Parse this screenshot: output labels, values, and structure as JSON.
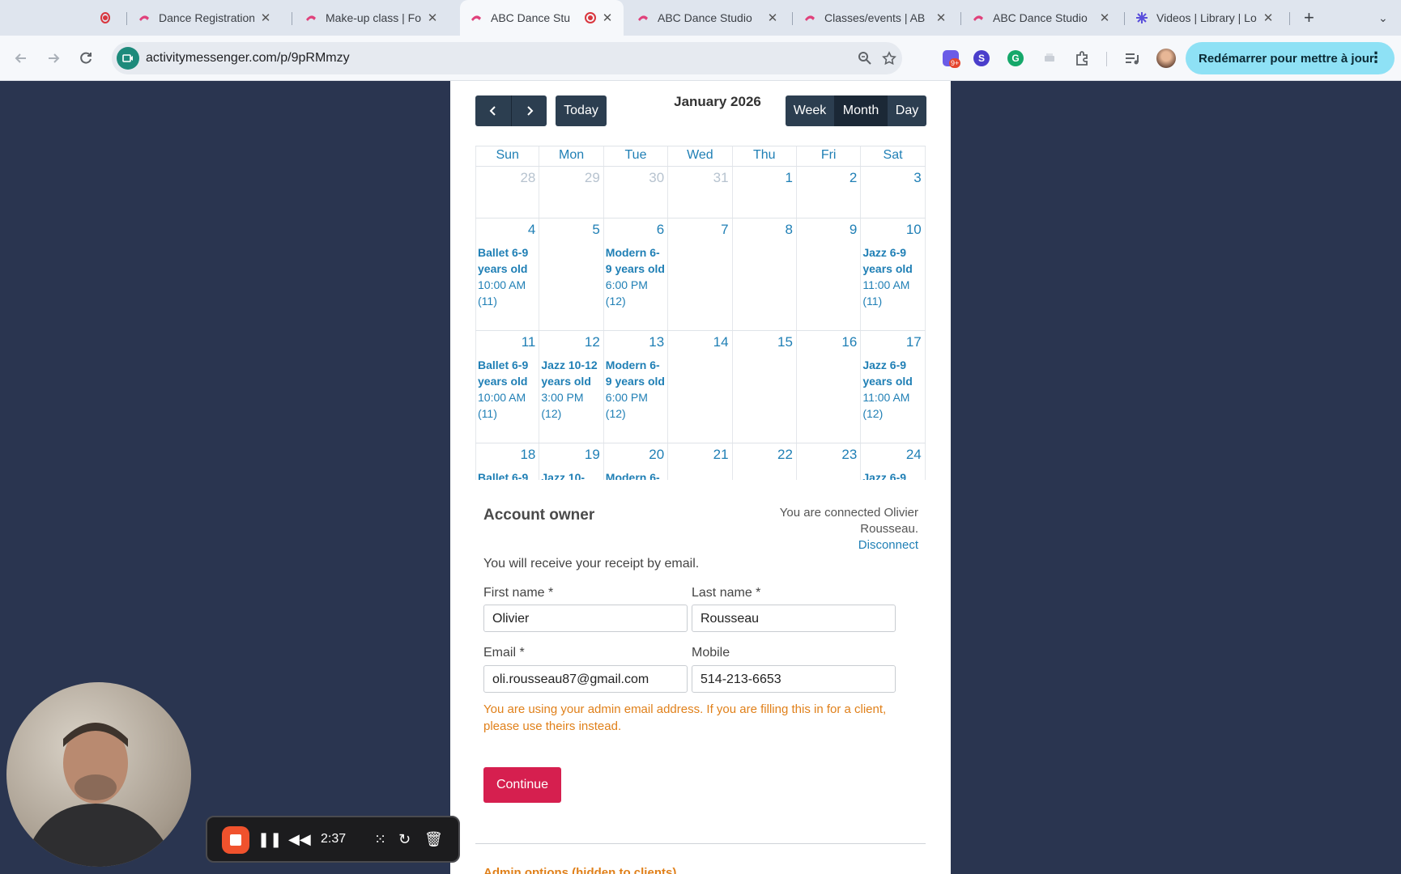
{
  "tabs": [
    {
      "title": "",
      "closable": false
    },
    {
      "title": "Dance Registration",
      "closable": true
    },
    {
      "title": "Make-up class | For",
      "closable": true
    },
    {
      "title": "ABC Dance Stu",
      "closable": true
    },
    {
      "title": "ABC Dance Studio",
      "closable": true
    },
    {
      "title": "Classes/events | AB",
      "closable": true
    },
    {
      "title": "ABC Dance Studio",
      "closable": true
    },
    {
      "title": "Videos | Library | Lo",
      "closable": true
    }
  ],
  "address_bar": {
    "url": "activitymessenger.com/p/9pRMmzy"
  },
  "update_button": {
    "label": "Redémarrer pour mettre à jour"
  },
  "extension_badge": "9+",
  "calendar": {
    "today_label": "Today",
    "title": "January 2026",
    "views": [
      "Week",
      "Month",
      "Day"
    ],
    "active_view": "Month",
    "weekdays": [
      "Sun",
      "Mon",
      "Tue",
      "Wed",
      "Thu",
      "Fri",
      "Sat"
    ],
    "weeks": [
      [
        {
          "day": "28",
          "muted": true
        },
        {
          "day": "29",
          "muted": true
        },
        {
          "day": "30",
          "muted": true
        },
        {
          "day": "31",
          "muted": true
        },
        {
          "day": "1"
        },
        {
          "day": "2"
        },
        {
          "day": "3"
        }
      ],
      [
        {
          "day": "4",
          "event": {
            "name": "Ballet 6-9 years old",
            "time": "10:00 AM",
            "count": "(11)"
          }
        },
        {
          "day": "5"
        },
        {
          "day": "6",
          "event": {
            "name": "Modern 6-9 years old",
            "time": "6:00 PM",
            "count": "(12)"
          }
        },
        {
          "day": "7"
        },
        {
          "day": "8"
        },
        {
          "day": "9"
        },
        {
          "day": "10",
          "event": {
            "name": "Jazz 6-9 years old",
            "time": "11:00 AM",
            "count": "(11)"
          }
        }
      ],
      [
        {
          "day": "11",
          "event": {
            "name": "Ballet 6-9 years old",
            "time": "10:00 AM",
            "count": "(11)"
          }
        },
        {
          "day": "12",
          "event": {
            "name": "Jazz 10-12 years old",
            "time": "3:00 PM",
            "count": "(12)"
          }
        },
        {
          "day": "13",
          "event": {
            "name": "Modern 6-9 years old",
            "time": "6:00 PM",
            "count": "(12)"
          }
        },
        {
          "day": "14"
        },
        {
          "day": "15"
        },
        {
          "day": "16"
        },
        {
          "day": "17",
          "event": {
            "name": "Jazz 6-9 years old",
            "time": "11:00 AM",
            "count": "(12)"
          }
        }
      ],
      [
        {
          "day": "18",
          "event": {
            "name": "Ballet 6-9",
            "time": "",
            "count": ""
          }
        },
        {
          "day": "19",
          "event": {
            "name": "Jazz 10-",
            "time": "",
            "count": ""
          }
        },
        {
          "day": "20",
          "event": {
            "name": "Modern 6-",
            "time": "",
            "count": ""
          }
        },
        {
          "day": "21"
        },
        {
          "day": "22"
        },
        {
          "day": "23"
        },
        {
          "day": "24",
          "event": {
            "name": "Jazz 6-9",
            "time": "",
            "count": ""
          }
        }
      ]
    ]
  },
  "form": {
    "title": "Account owner",
    "connected_text": "You are connected Olivier Rousseau.",
    "disconnect_label": "Disconnect",
    "receipt_text": "You will receive your receipt by email.",
    "first_name_label": "First name *",
    "first_name_value": "Olivier",
    "last_name_label": "Last name *",
    "last_name_value": "Rousseau",
    "email_label": "Email *",
    "email_value": "oli.rousseau87@gmail.com",
    "mobile_label": "Mobile",
    "mobile_value": "514-213-6653",
    "warning": "You are using your admin email address. If you are filling this in for a client, please use theirs instead.",
    "continue_label": "Continue",
    "admin_options": "Admin options (hidden to clients)"
  },
  "recorder": {
    "time": "2:37"
  },
  "colors": {
    "accent": "#1f7fb5",
    "button": "#2c3e50",
    "primary": "#d61f4f",
    "warning": "#e0801a",
    "page_bg": "#2a3550"
  }
}
